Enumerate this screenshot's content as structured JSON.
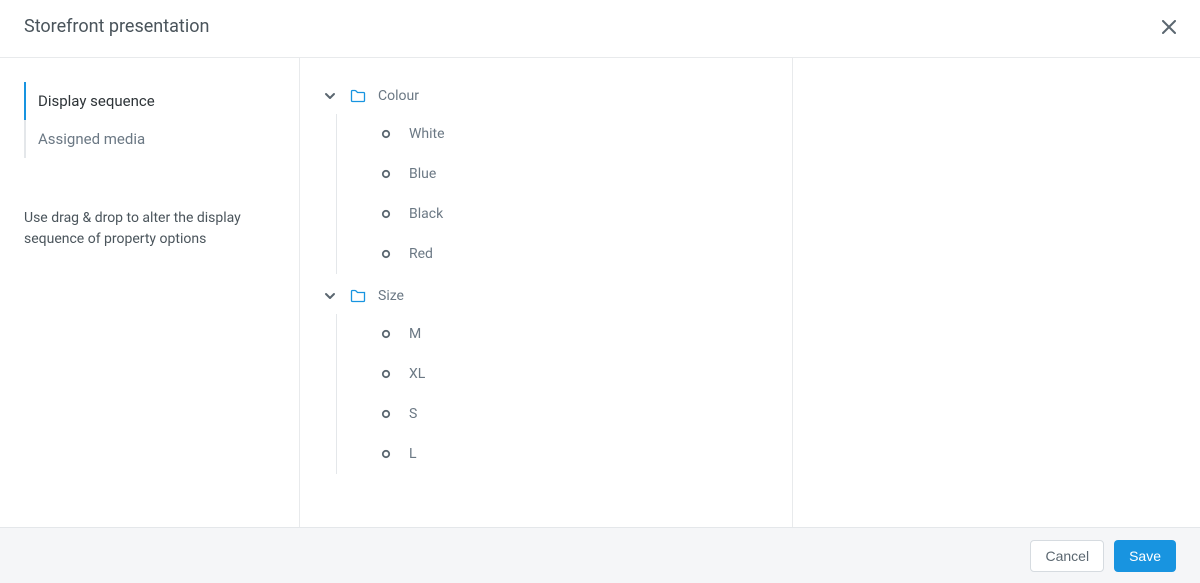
{
  "header": {
    "title": "Storefront presentation"
  },
  "sidebar": {
    "tabs": [
      {
        "label": "Display sequence",
        "active": true
      },
      {
        "label": "Assigned media",
        "active": false
      }
    ],
    "help": "Use drag & drop to alter the display sequence of property options"
  },
  "groups": [
    {
      "label": "Colour",
      "options": [
        {
          "label": "White"
        },
        {
          "label": "Blue"
        },
        {
          "label": "Black"
        },
        {
          "label": "Red"
        }
      ]
    },
    {
      "label": "Size",
      "options": [
        {
          "label": "M"
        },
        {
          "label": "XL"
        },
        {
          "label": "S"
        },
        {
          "label": "L"
        }
      ]
    }
  ],
  "footer": {
    "cancel": "Cancel",
    "save": "Save"
  }
}
